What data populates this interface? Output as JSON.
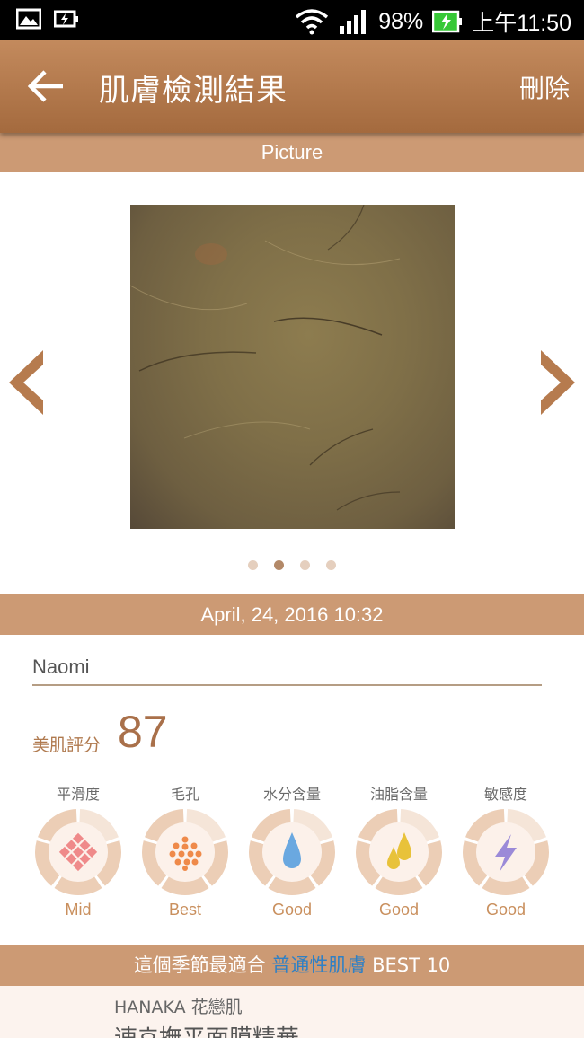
{
  "status_bar": {
    "battery": "98%",
    "time": "上午11:50"
  },
  "app_bar": {
    "title": "肌膚檢測結果",
    "delete_label": "刪除"
  },
  "picture_header": "Picture",
  "carousel": {
    "page_count": 4,
    "active_index": 1
  },
  "timestamp": "April, 24, 2016 10:32",
  "user_name": "Naomi",
  "score": {
    "label": "美肌評分",
    "value": "87"
  },
  "metrics": [
    {
      "title": "平滑度",
      "value": "Mid",
      "icon": "grid-diamond-icon",
      "color": "#ef8a8a"
    },
    {
      "title": "毛孔",
      "value": "Best",
      "icon": "pores-dots-icon",
      "color": "#ef8a4a"
    },
    {
      "title": "水分含量",
      "value": "Good",
      "icon": "water-drop-icon",
      "color": "#6aa8e0"
    },
    {
      "title": "油脂含量",
      "value": "Good",
      "icon": "oil-drops-icon",
      "color": "#e8c23a"
    },
    {
      "title": "敏感度",
      "value": "Good",
      "icon": "lightning-icon",
      "color": "#9b8ad8"
    }
  ],
  "recommendation": {
    "prefix": "這個季節最適合",
    "highlight": "普通性肌膚",
    "suffix": "BEST 10"
  },
  "product": {
    "brand": "HANAKA 花戀肌",
    "name": "速효撫平面膜精華"
  },
  "colors": {
    "accent": "#cc9a74",
    "app_bar": "#b67b4e",
    "score": "#a9704a",
    "highlight": "#2f80c5"
  }
}
